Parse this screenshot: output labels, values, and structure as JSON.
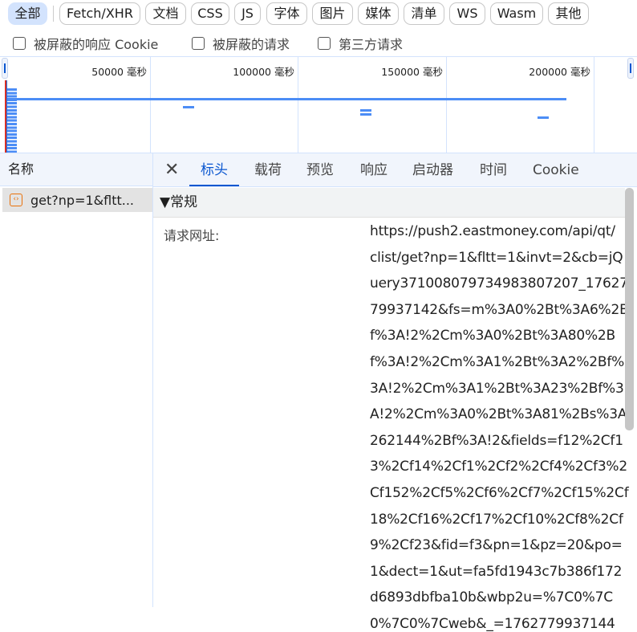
{
  "filters": [
    "全部",
    "Fetch/XHR",
    "文档",
    "CSS",
    "JS",
    "字体",
    "图片",
    "媒体",
    "清单",
    "WS",
    "Wasm",
    "其他"
  ],
  "selected_filter": "全部",
  "checkboxes": [
    "被屏蔽的响应 Cookie",
    "被屏蔽的请求",
    "第三方请求"
  ],
  "timeline": {
    "ticks": [
      "50000 毫秒",
      "100000 毫秒",
      "150000 毫秒",
      "200000 毫秒"
    ]
  },
  "requests": {
    "header": "名称",
    "items": [
      {
        "name": "get?np=1&fltt..."
      }
    ]
  },
  "detail": {
    "tabs": [
      "标头",
      "载荷",
      "预览",
      "响应",
      "启动器",
      "时间",
      "Cookie"
    ],
    "active_tab": "标头",
    "section": "▼常规",
    "label": "请求网址:",
    "url_lines": [
      "https://push2.eastmoney.com/api/qt/",
      "clist/get?np=1&fltt=1&invt=2&cb=jQ",
      "uery371008079734983807207_17627",
      "79937142&fs=m%3A0%2Bt%3A6%2B",
      "f%3A!2%2Cm%3A0%2Bt%3A80%2B",
      "f%3A!2%2Cm%3A1%2Bt%3A2%2Bf%",
      "3A!2%2Cm%3A1%2Bt%3A23%2Bf%3",
      "A!2%2Cm%3A0%2Bt%3A81%2Bs%3A",
      "262144%2Bf%3A!2&fields=f12%2Cf1",
      "3%2Cf14%2Cf1%2Cf2%2Cf4%2Cf3%2",
      "Cf152%2Cf5%2Cf6%2Cf7%2Cf15%2Cf",
      "18%2Cf16%2Cf17%2Cf10%2Cf8%2Cf",
      "9%2Cf23&fid=f3&pn=1&pz=20&po=",
      "1&dect=1&ut=fa5fd1943c7b386f172",
      "d6893dbfba10b&wbp2u=%7C0%7C",
      "0%7C0%7Cweb&_=1762779937144"
    ]
  }
}
